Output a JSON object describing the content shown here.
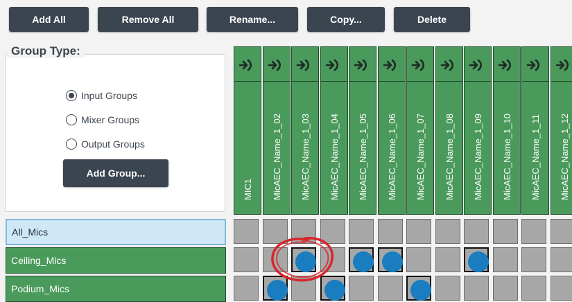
{
  "toolbar": {
    "buttons": [
      "Add All",
      "Remove All",
      "Rename...",
      "Copy...",
      "Delete"
    ]
  },
  "group_type": {
    "title": "Group Type:",
    "options": [
      {
        "label": "Input Groups",
        "selected": true
      },
      {
        "label": "Mixer Groups",
        "selected": false
      },
      {
        "label": "Output Groups",
        "selected": false
      }
    ],
    "add_label": "Add Group..."
  },
  "columns": [
    "MIC1",
    "MicAEC_Name_1_02",
    "MicAEC_Name_1_03",
    "MicAEC_Name_1_04",
    "MicAEC_Name_1_05",
    "MicAEC_Name_1_06",
    "MicAEC_Name_1_07",
    "MicAEC_Name_1_08",
    "MicAEC_Name_1_09",
    "MicAEC_Name_1_10",
    "MicAEC_Name_1_11",
    "MicAEC_Name_1_12"
  ],
  "column_icon": "input-arrow-icon",
  "rows": [
    {
      "label": "All_Mics",
      "selected": true,
      "cells": [
        0,
        0,
        0,
        0,
        0,
        0,
        0,
        0,
        0,
        0,
        0,
        0
      ]
    },
    {
      "label": "Ceiling_Mics",
      "selected": false,
      "cells": [
        0,
        0,
        1,
        0,
        1,
        1,
        0,
        0,
        1,
        0,
        0,
        0
      ]
    },
    {
      "label": "Podium_Mics",
      "selected": false,
      "cells": [
        0,
        1,
        0,
        1,
        0,
        0,
        1,
        0,
        0,
        0,
        0,
        0
      ]
    }
  ],
  "colors": {
    "button_bg": "#3b4550",
    "group_green": "#4a9a5c",
    "selected_row": "#cfe8f7",
    "assigned_dot": "#1a7dbf",
    "annotation": "#d7262b"
  }
}
